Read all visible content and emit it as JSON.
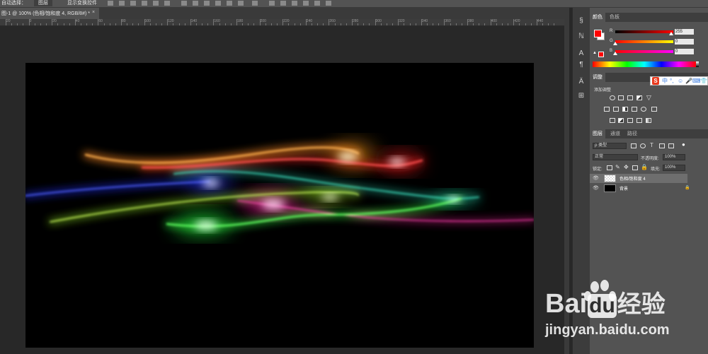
{
  "options_bar": {
    "auto_select_label": "自动选择：",
    "auto_select_value": "图层",
    "show_transform_label": "显示变换控件"
  },
  "document_tab": {
    "title": "图-1 @ 100% (色相/饱和度 4, RGB/8#) *",
    "close": "×"
  },
  "ruler": {
    "numbers": [
      "20",
      "0",
      "20",
      "40",
      "60",
      "80",
      "100",
      "120",
      "140",
      "160",
      "180",
      "200",
      "220",
      "240",
      "260",
      "280",
      "300",
      "320",
      "340",
      "360",
      "380",
      "400",
      "420",
      "440"
    ]
  },
  "tools": [
    "§",
    "ℕ",
    "A",
    "¶",
    "Ä",
    "⊞"
  ],
  "color_panel": {
    "tabs": [
      "颜色",
      "色板"
    ],
    "channels": [
      {
        "label": "R",
        "value": "255",
        "fill": "#ff0000"
      },
      {
        "label": "G",
        "value": "0",
        "fill": "#ffd000"
      },
      {
        "label": "B",
        "value": "0",
        "fill": "#ff00ff"
      }
    ],
    "foreground": "#ff0000",
    "background": "#ffffff"
  },
  "adjust_panel": {
    "tabs": [
      "调整"
    ],
    "add_label": "添加调整"
  },
  "sogou_bar": {
    "logo": "S",
    "items": [
      "中",
      "°,",
      "☺",
      "🎤",
      "⌨",
      "👕",
      "⊞"
    ]
  },
  "layers_panel": {
    "tabs": [
      "图层",
      "通道",
      "路径"
    ],
    "filter_kind": "ρ 类型",
    "blend_mode": "正常",
    "opacity_label": "不透明度:",
    "opacity_value": "100%",
    "lock_label": "锁定:",
    "fill_label": "填充:",
    "fill_value": "100%",
    "layers": [
      {
        "name": "色相/饱和度 4",
        "selected": true
      },
      {
        "name": "背景",
        "selected": false,
        "locked": "🔒"
      }
    ]
  },
  "watermark": {
    "brand": "Bai",
    "brand2": "du",
    "jingyan": "经验",
    "url": "jingyan.baidu.com"
  }
}
